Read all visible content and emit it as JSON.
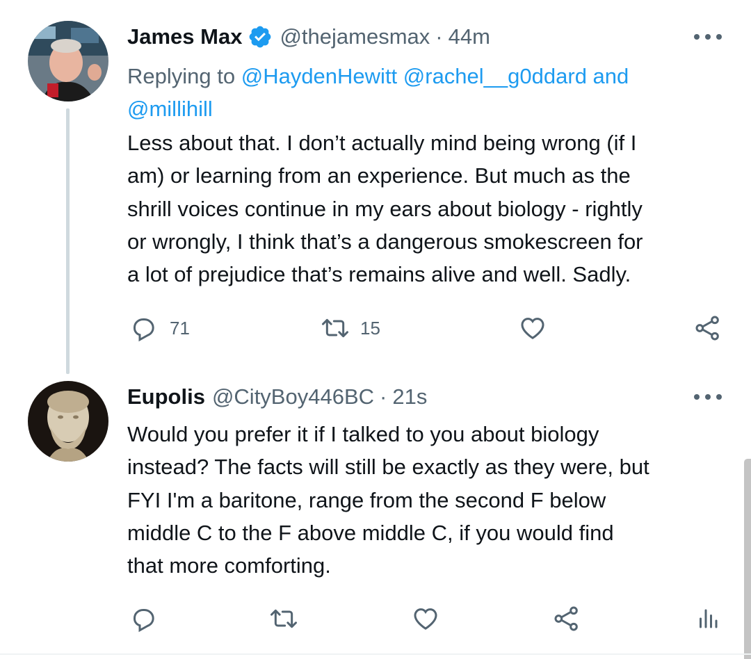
{
  "tweet1": {
    "name": "James Max",
    "handle": "@thejamesmax",
    "separator": "·",
    "time": "44m",
    "replying_prefix": "Replying to",
    "replying_mentions_1": "@HaydenHewitt @rachel__g0ddard and",
    "replying_mentions_2": "@millihill",
    "lines": [
      "Less about that. I don’t actually mind being wrong (if I",
      "am) or learning from an experience. But much as the",
      "shrill voices continue in my ears about biology - rightly",
      "or wrongly, I think that’s a dangerous smokescreen for",
      "a lot of prejudice that’s remains alive and well. Sadly."
    ],
    "reply_count": "71",
    "retweet_count": "15"
  },
  "tweet2": {
    "name": "Eupolis",
    "handle": "@CityBoy446BC",
    "separator": "·",
    "time": "21s",
    "lines": [
      "Would you prefer it if I talked to you about biology",
      "instead? The facts will still be exactly as they were, but",
      "FYI I'm a baritone, range from the second F below",
      "middle C to the F above middle C, if you would find",
      "that more comforting."
    ]
  },
  "icons": {
    "reply": "reply-icon",
    "retweet": "retweet-icon",
    "like": "heart-icon",
    "share": "share-icon",
    "analytics": "analytics-icon",
    "verified": "verified-badge-icon",
    "more": "more-icon"
  },
  "colors": {
    "text": "#0f1419",
    "secondary": "#536471",
    "accent": "#1d9bf0",
    "thread_line": "#cfd9de"
  }
}
